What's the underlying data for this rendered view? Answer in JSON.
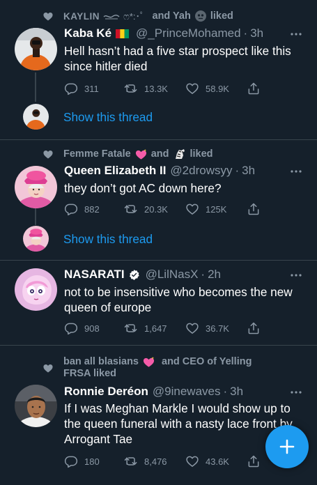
{
  "tweets": [
    {
      "social_pre": "KAYLIN",
      "social_mid": "ෆ*:･ﾟ",
      "social_and": "and Yah",
      "social_liked": "liked",
      "name": "Kaba Ké",
      "handle": "@_PrinceMohamed",
      "sep": "·",
      "time": "3h",
      "text": "Hell hasn’t had a five star prospect like this since hitler died",
      "replies": "311",
      "retweets": "13.3K",
      "likes": "58.9K",
      "show_thread": "Show this thread"
    },
    {
      "social_text_a": "Femme Fatale",
      "social_and": "and",
      "social_liked": "liked",
      "name": "Queen Elizabeth II",
      "handle": "@2drowsyy",
      "sep": "·",
      "time": "3h",
      "text": "they don’t got AC down here?",
      "replies": "882",
      "retweets": "20.3K",
      "likes": "125K",
      "show_thread": "Show this thread"
    },
    {
      "name": "NASARATI",
      "handle": "@LilNasX",
      "sep": "·",
      "time": "2h",
      "text": "not to be insensitive who becomes the new queen of europe",
      "replies": "908",
      "retweets": "1,647",
      "likes": "36.7K"
    },
    {
      "social_line1_a": "ban all blasians",
      "social_line1_b": "and CEO of Yelling",
      "social_line2": "FRSA liked",
      "name": "Ronnie Deréon",
      "handle": "@9inewaves",
      "sep": "·",
      "time": "3h",
      "text": "If I was Meghan Markle I would show up to the queen funeral with a nasty lace front by Arrogant Tae",
      "replies": "180",
      "retweets": "8,476",
      "likes": "43.6K"
    }
  ],
  "colors": {
    "background": "#15202b",
    "divider": "#38444d",
    "secondary_text": "#8b98a5",
    "accent": "#1d9bf0"
  },
  "icons": [
    "heart-icon",
    "more-icon",
    "reply-icon",
    "retweet-icon",
    "like-icon",
    "share-icon",
    "verified-icon",
    "compose-icon"
  ]
}
